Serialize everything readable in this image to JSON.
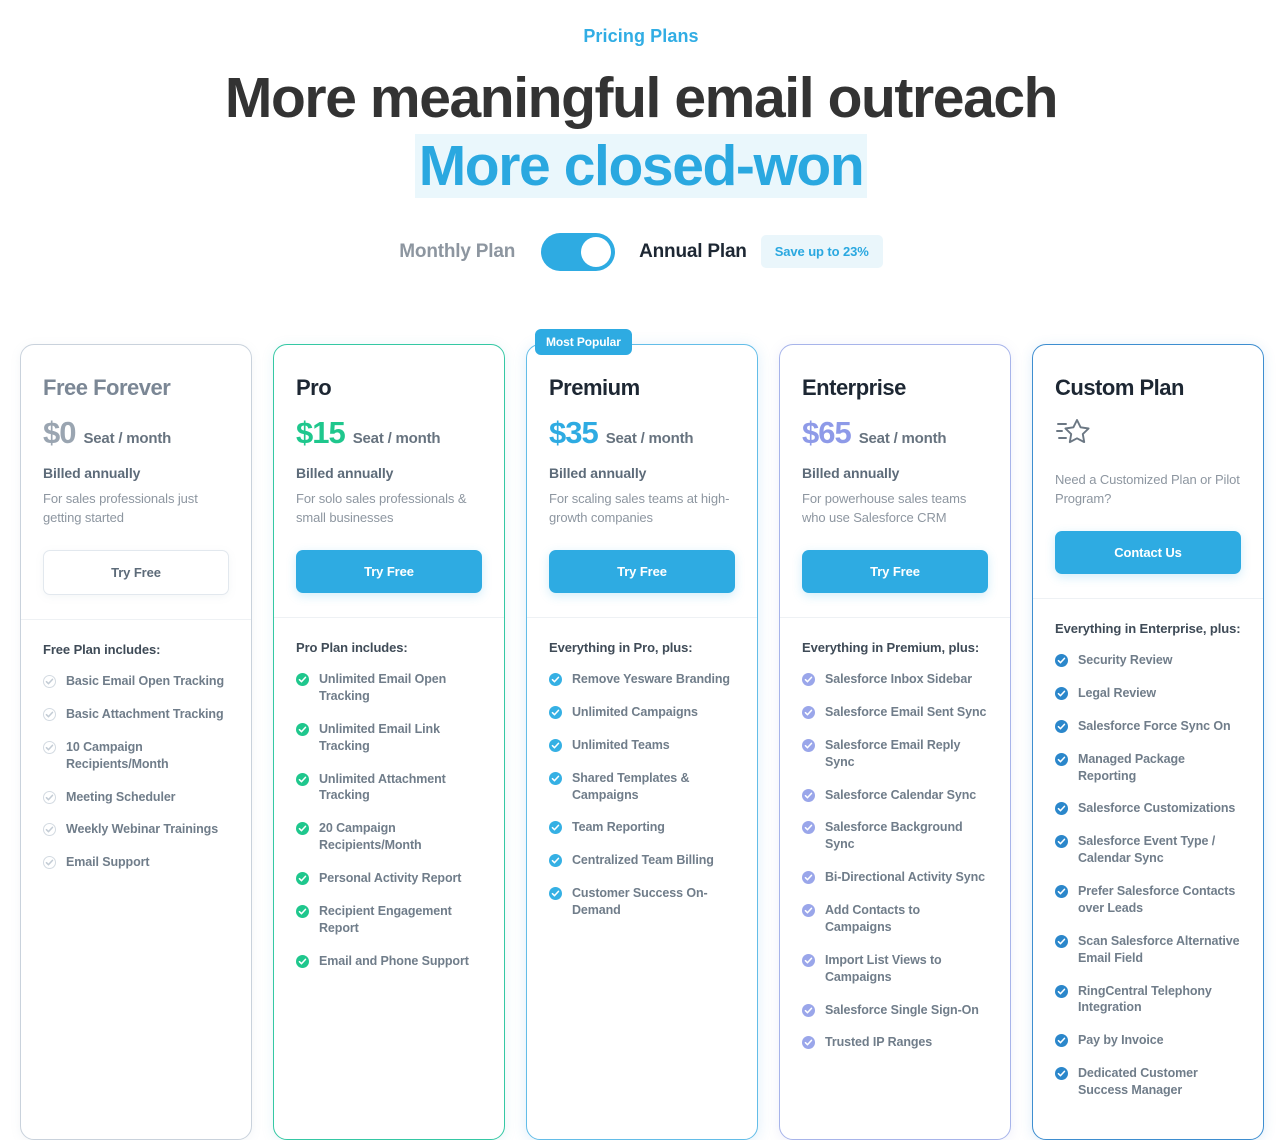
{
  "header": {
    "eyebrow": "Pricing Plans",
    "headline_line1": "More meaningful email outreach",
    "headline_line2": "More closed-won"
  },
  "toggle": {
    "monthly_label": "Monthly Plan",
    "annual_label": "Annual Plan",
    "save_badge": "Save up to 23%",
    "state": "annual",
    "active_color": "#2eabe2"
  },
  "plans": [
    {
      "name": "Free Forever",
      "price": "$0",
      "price_unit": "Seat / month",
      "billed": "Billed annually",
      "blurb": "For sales professionals just getting started",
      "cta": "Try Free",
      "cta_style": "outline",
      "includes_title": "Free Plan includes:",
      "badge": null,
      "accent": "#9aa5b1",
      "border": "#c9d2dc",
      "check_style": "gray",
      "features": [
        "Basic Email Open Tracking",
        "Basic Attachment Tracking",
        "10 Campaign Recipients/Month",
        "Meeting Scheduler",
        "Weekly Webinar Trainings",
        "Email Support"
      ]
    },
    {
      "name": "Pro",
      "price": "$15",
      "price_unit": "Seat / month",
      "billed": "Billed annually",
      "blurb": "For solo sales professionals & small businesses",
      "cta": "Try Free",
      "cta_style": "filled",
      "includes_title": "Pro Plan includes:",
      "badge": null,
      "accent": "#1fc78d",
      "border": "#35c8a4",
      "check_style": "green",
      "features": [
        "Unlimited Email Open Tracking",
        "Unlimited Email Link Tracking",
        "Unlimited Attachment Tracking",
        "20 Campaign Recipients/Month",
        "Personal Activity Report",
        "Recipient Engagement Report",
        "Email and Phone Support"
      ]
    },
    {
      "name": "Premium",
      "price": "$35",
      "price_unit": "Seat / month",
      "billed": "Billed annually",
      "blurb": "For scaling sales teams at high-growth companies",
      "cta": "Try Free",
      "cta_style": "filled",
      "includes_title": "Everything in Pro, plus:",
      "badge": "Most Popular",
      "accent": "#2eabe2",
      "border": "#63bde8",
      "check_style": "blue",
      "features": [
        "Remove Yesware Branding",
        "Unlimited Campaigns",
        "Unlimited Teams",
        "Shared Templates & Campaigns",
        "Team Reporting",
        "Centralized Team Billing",
        "Customer Success On-Demand"
      ]
    },
    {
      "name": "Enterprise",
      "price": "$65",
      "price_unit": "Seat / month",
      "billed": "Billed annually",
      "blurb": "For powerhouse sales teams who use Salesforce CRM",
      "cta": "Try Free",
      "cta_style": "filled",
      "includes_title": "Everything in Premium, plus:",
      "badge": null,
      "accent": "#8e9ae8",
      "border": "#a7b4ea",
      "check_style": "purple",
      "features": [
        "Salesforce Inbox Sidebar",
        "Salesforce Email Sent Sync",
        "Salesforce Email Reply Sync",
        "Salesforce Calendar Sync",
        "Salesforce Background Sync",
        "Bi-Directional Activity Sync",
        "Add Contacts to Campaigns",
        "Import List Views to Campaigns",
        "Salesforce Single Sign-On",
        "Trusted IP Ranges"
      ]
    },
    {
      "name": "Custom Plan",
      "price": null,
      "price_unit": null,
      "icon": "shooting-star-icon",
      "billed": null,
      "blurb": "Need a Customized Plan or Pilot Program?",
      "cta": "Contact Us",
      "cta_style": "filled",
      "includes_title": "Everything in Enterprise, plus:",
      "badge": null,
      "accent": "#2b87cb",
      "border": "#3e8ed0",
      "check_style": "dblue",
      "features": [
        "Security Review",
        "Legal Review",
        "Salesforce Force Sync On",
        "Managed Package Reporting",
        "Salesforce Customizations",
        "Salesforce Event Type / Calendar Sync",
        "Prefer Salesforce Contacts over Leads",
        "Scan Salesforce Alternative Email Field",
        "RingCentral Telephony Integration",
        "Pay by Invoice",
        "Dedicated Customer Success Manager"
      ]
    }
  ]
}
